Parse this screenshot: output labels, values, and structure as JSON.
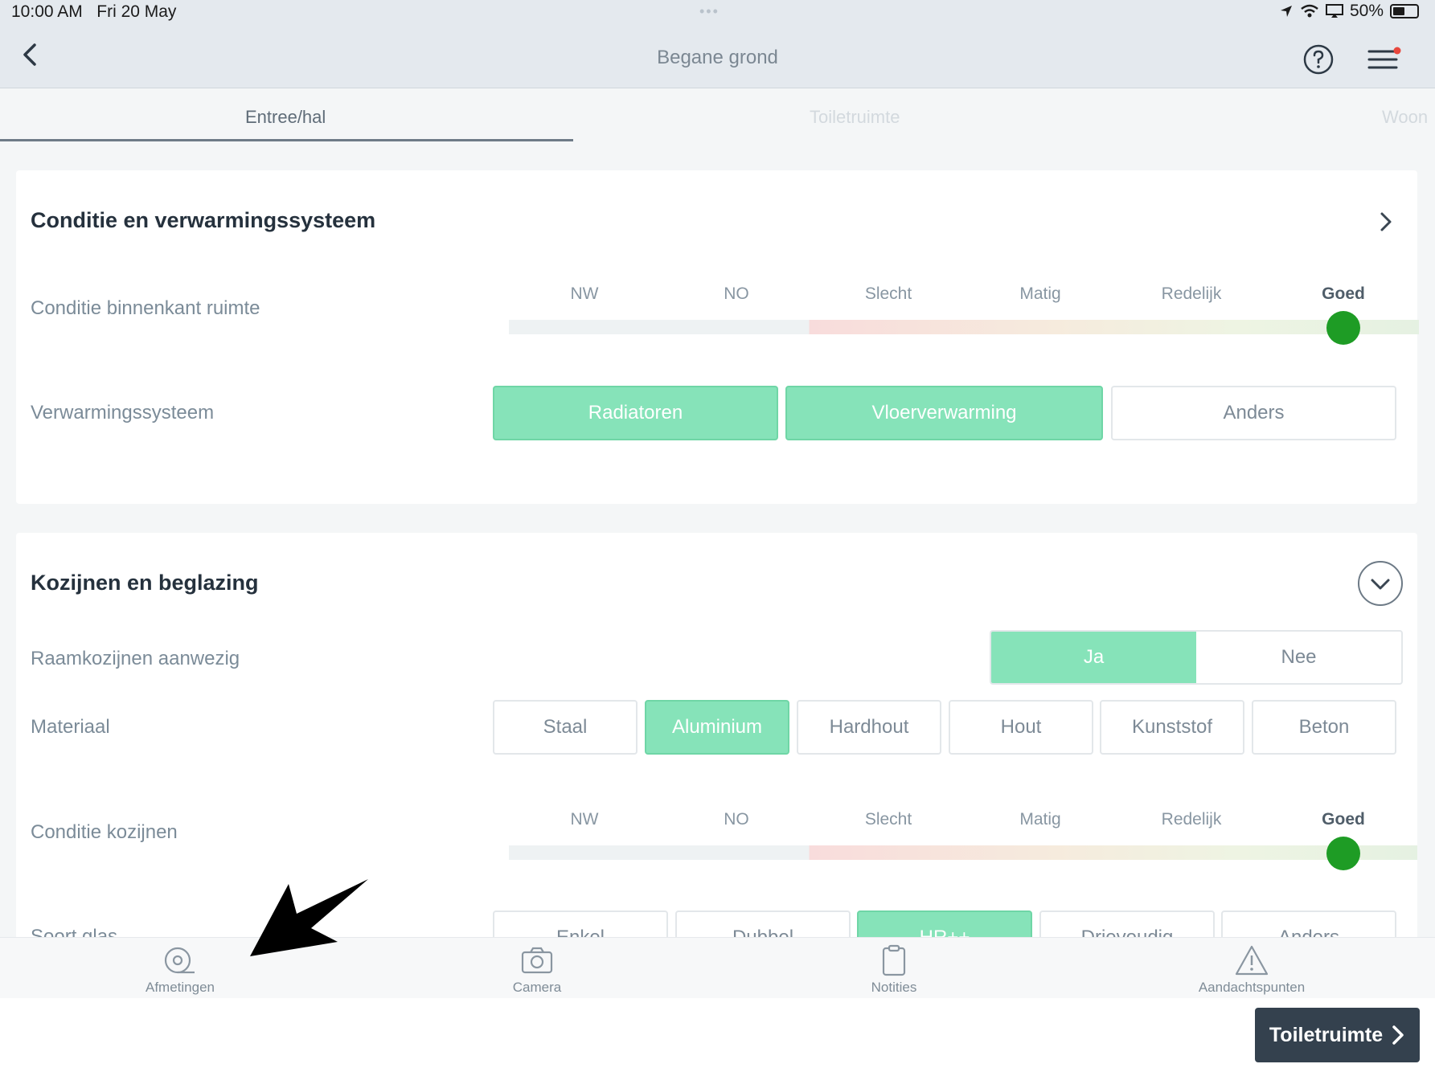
{
  "status_bar": {
    "time": "10:00 AM",
    "date": "Fri 20 May",
    "battery": "50%"
  },
  "nav": {
    "title": "Begane grond",
    "back_icon": "chevron-left-icon",
    "help_icon": "question-circle-icon",
    "menu_icon": "hamburger-menu-icon"
  },
  "tabs": [
    {
      "label": "Entree/hal",
      "active": true
    },
    {
      "label": "Toiletruimte",
      "active": false
    },
    {
      "label": "Woon",
      "active": false
    }
  ],
  "section1": {
    "title": "Conditie en verwarmingssysteem",
    "condition_label": "Conditie binnenkant ruimte",
    "scale_labels": [
      "NW",
      "NO",
      "Slecht",
      "Matig",
      "Redelijk",
      "Goed"
    ],
    "selected": "Goed",
    "heating_label": "Verwarmingssysteem",
    "heating_options": [
      {
        "label": "Radiatoren",
        "selected": true
      },
      {
        "label": "Vloerverwarming",
        "selected": true
      },
      {
        "label": "Anders",
        "selected": false
      }
    ]
  },
  "section2": {
    "title": "Kozijnen en beglazing",
    "frames_label": "Raamkozijnen aanwezig",
    "frames_options": [
      {
        "label": "Ja",
        "selected": true
      },
      {
        "label": "Nee",
        "selected": false
      }
    ],
    "material_label": "Materiaal",
    "material_options": [
      {
        "label": "Staal",
        "selected": false
      },
      {
        "label": "Aluminium",
        "selected": true
      },
      {
        "label": "Hardhout",
        "selected": false
      },
      {
        "label": "Hout",
        "selected": false
      },
      {
        "label": "Kunststof",
        "selected": false
      },
      {
        "label": "Beton",
        "selected": false
      }
    ],
    "frame_condition_label": "Conditie kozijnen",
    "scale_labels": [
      "NW",
      "NO",
      "Slecht",
      "Matig",
      "Redelijk",
      "Goed"
    ],
    "selected": "Goed",
    "glass_label": "Soort glas",
    "glass_options": [
      {
        "label": "Enkel",
        "selected": false
      },
      {
        "label": "Dubbel",
        "selected": false
      },
      {
        "label": "HR++",
        "selected": true
      },
      {
        "label": "Drievoudig",
        "selected": false
      },
      {
        "label": "Anders",
        "selected": false
      }
    ]
  },
  "toolbar": [
    {
      "label": "Afmetingen",
      "icon": "measuring-tape-icon"
    },
    {
      "label": "Camera",
      "icon": "camera-icon"
    },
    {
      "label": "Notities",
      "icon": "clipboard-icon"
    },
    {
      "label": "Aandachtspunten",
      "icon": "warning-triangle-icon"
    }
  ],
  "next_button": {
    "label": "Toiletruimte"
  }
}
